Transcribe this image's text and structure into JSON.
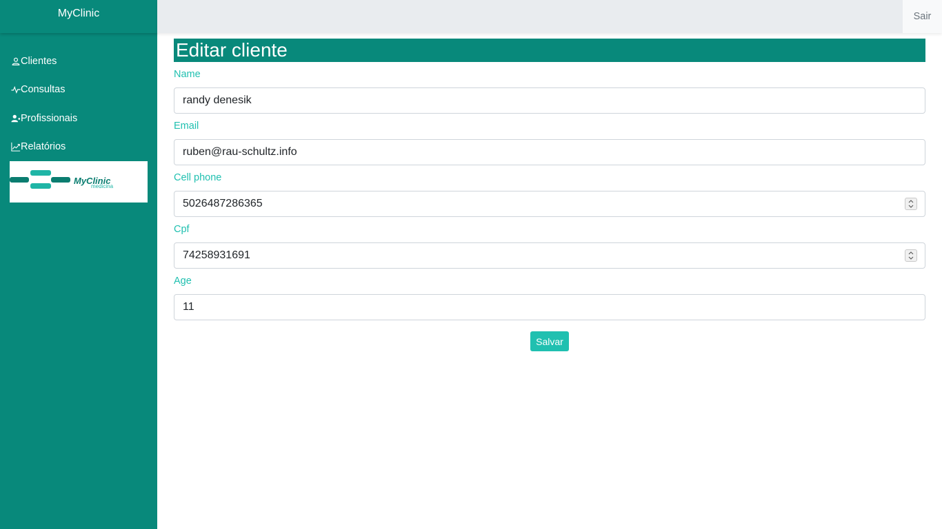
{
  "app": {
    "brand": "MyClinic",
    "logo_text_main": "MyClinic",
    "logo_text_sub": "medicina"
  },
  "sidebar": {
    "items": [
      {
        "label": "Clientes",
        "icon": "person-icon"
      },
      {
        "label": "Consultas",
        "icon": "pulse-icon"
      },
      {
        "label": "Profissionais",
        "icon": "users-icon"
      },
      {
        "label": "Relatórios",
        "icon": "chart-icon"
      }
    ]
  },
  "topbar": {
    "logout_label": "Sair"
  },
  "page": {
    "title": "Editar cliente"
  },
  "form": {
    "name": {
      "label": "Name",
      "value": "randy denesik"
    },
    "email": {
      "label": "Email",
      "value": "ruben@rau-schultz.info"
    },
    "cell_phone": {
      "label": "Cell phone",
      "value": "5026487286365"
    },
    "cpf": {
      "label": "Cpf",
      "value": "74258931691"
    },
    "age": {
      "label": "Age",
      "value": "11"
    },
    "submit_label": "Salvar"
  },
  "colors": {
    "primary": "#08897b",
    "accent": "#20c0b0",
    "topbar": "#e9ecef"
  }
}
